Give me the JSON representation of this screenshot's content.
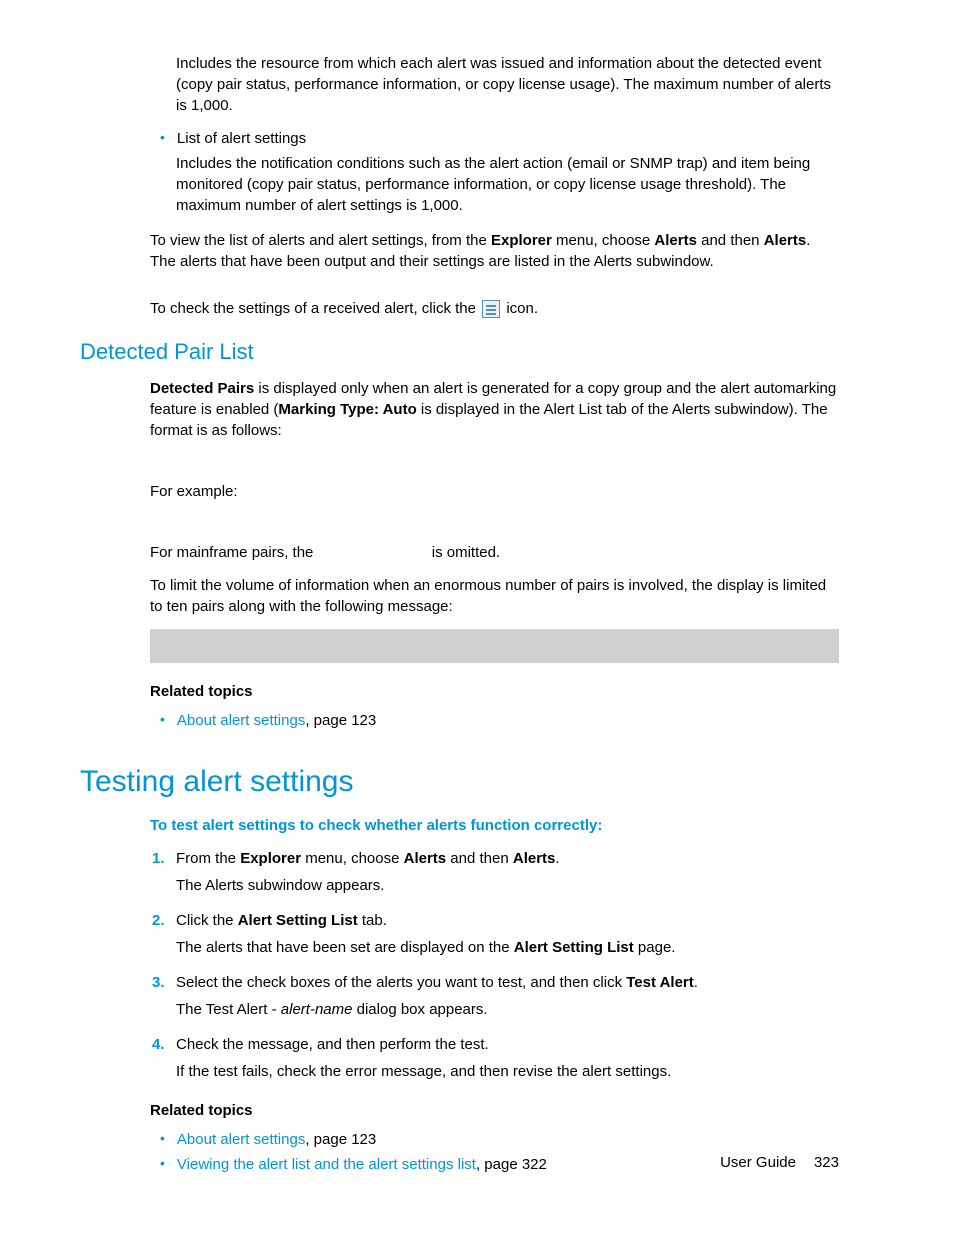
{
  "top": {
    "p1": "Includes the resource from which each alert was issued and information about the detected event (copy pair status, performance information, or copy license usage). The maximum number of alerts is 1,000.",
    "bullet_label": "List of alert settings",
    "bullet_desc": "Includes the notification conditions such as the alert action (email or SNMP trap) and item being monitored (copy pair status, performance information, or copy license usage threshold). The maximum number of alert settings is 1,000.",
    "p2_a": "To view the list of alerts and alert settings, from the ",
    "p2_b": "Explorer",
    "p2_c": " menu, choose ",
    "p2_d": "Alerts",
    "p2_e": " and then ",
    "p2_f": "Alerts",
    "p2_g": ". The alerts that have been output and their settings are listed in the Alerts subwindow.",
    "p3_a": "To check the settings of a received alert, click the ",
    "p3_b": " icon."
  },
  "dpl": {
    "heading": "Detected Pair List",
    "p1_a": "Detected Pairs",
    "p1_b": " is displayed only when an alert is generated for a copy group and the alert automarking feature is enabled (",
    "p1_c": "Marking Type: Auto",
    "p1_d": " is displayed in the Alert List tab of the Alerts subwindow). The format is as follows:",
    "p2": "For example:",
    "p3_a": "For mainframe pairs, the ",
    "p3_b": " is omitted.",
    "p4": "To limit the volume of information when an enormous number of pairs is involved, the display is limited to ten pairs along with the following message:",
    "related_hdr": "Related topics",
    "rel1_link": "About alert settings",
    "rel1_rest": ", page 123"
  },
  "tas": {
    "heading": "Testing alert settings",
    "intro": "To test alert settings to check whether alerts function correctly:",
    "s1_a": "From the ",
    "s1_b": "Explorer",
    "s1_c": " menu, choose ",
    "s1_d": "Alerts",
    "s1_e": " and then ",
    "s1_f": "Alerts",
    "s1_g": ".",
    "s1_sub": "The Alerts subwindow appears.",
    "s2_a": "Click the ",
    "s2_b": "Alert Setting List",
    "s2_c": " tab.",
    "s2_sub_a": "The alerts that have been set are displayed on the ",
    "s2_sub_b": "Alert Setting List",
    "s2_sub_c": " page.",
    "s3_a": "Select the check boxes of the alerts you want to test, and then click ",
    "s3_b": "Test Alert",
    "s3_c": ".",
    "s3_sub_a": "The Test Alert - ",
    "s3_sub_b": "alert-name",
    "s3_sub_c": " dialog box appears.",
    "s4": "Check the message, and then perform the test.",
    "s4_sub": "If the test fails, check the error message, and then revise the alert settings.",
    "related_hdr": "Related topics",
    "rel1_link": "About alert settings",
    "rel1_rest": ", page 123",
    "rel2_link": "Viewing the alert list and the alert settings list",
    "rel2_rest": ", page 322",
    "n1": "1.",
    "n2": "2.",
    "n3": "3.",
    "n4": "4."
  },
  "footer": {
    "label": "User Guide",
    "page": "323"
  }
}
